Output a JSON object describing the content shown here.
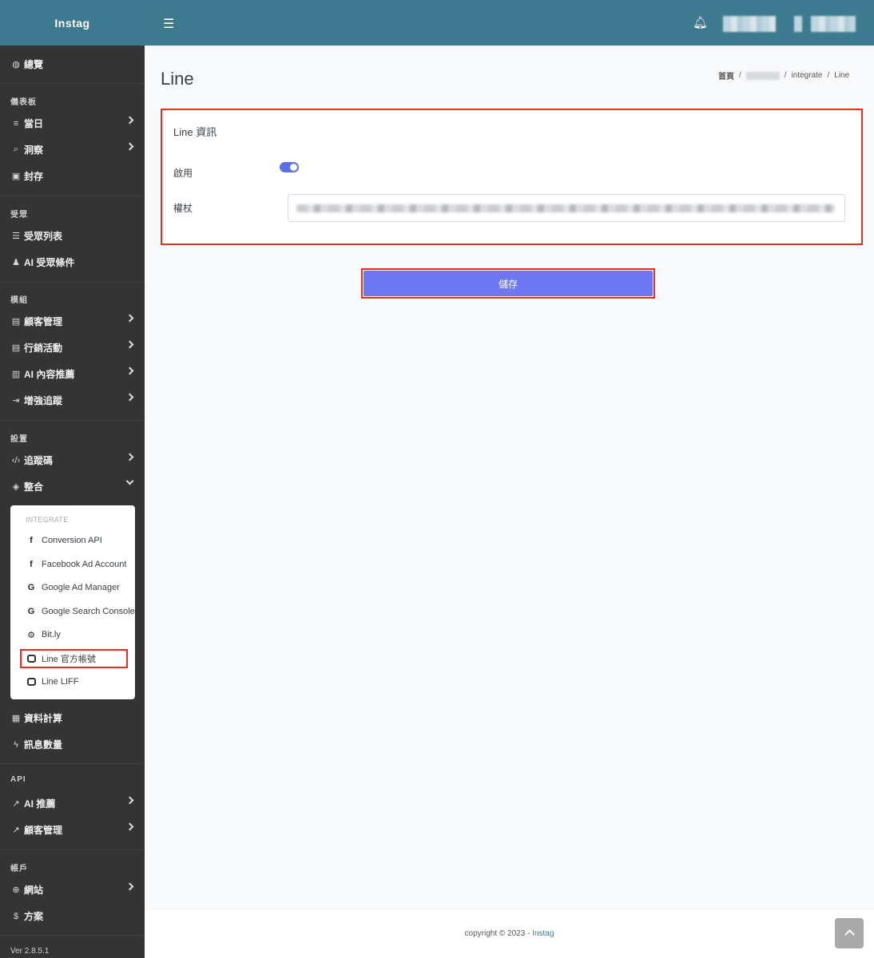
{
  "brand": "Instag",
  "header": {
    "menu_icon": "hamburger-icon",
    "bell_icon": "bell-icon"
  },
  "sidebar": {
    "overview": "總覽",
    "sections": {
      "dashboard": "儀表板",
      "audience": "受眾",
      "modules": "模組",
      "settings": "設置",
      "api": "API",
      "account": "帳戶"
    },
    "items": {
      "daily": "當日",
      "insight": "洞察",
      "archive": "封存",
      "audience_list": "受眾列表",
      "ai_audience": "AI 受眾條件",
      "customer_mgmt": "顧客管理",
      "marketing": "行銷活動",
      "ai_content": "AI 內容推薦",
      "enhanced_tracking": "增強追蹤",
      "tracking_code": "追蹤碼",
      "integration": "整合",
      "data_calc": "資料計算",
      "message_count": "訊息數量",
      "ai_recommend": "AI 推薦",
      "api_customer_mgmt": "顧客管理",
      "website": "網站",
      "plan": "方案"
    },
    "version": "Ver 2.8.5.1"
  },
  "submenu": {
    "header": "INTEGRATE",
    "items": [
      {
        "label": "Conversion API",
        "icon": "facebook-icon"
      },
      {
        "label": "Facebook Ad Account",
        "icon": "facebook-icon"
      },
      {
        "label": "Google Ad Manager",
        "icon": "google-icon"
      },
      {
        "label": "Google Search Console",
        "icon": "google-icon"
      },
      {
        "label": "Bit.ly",
        "icon": "gear-icon"
      },
      {
        "label": "Line 官方帳號",
        "icon": "line-icon"
      },
      {
        "label": "Line LIFF",
        "icon": "line-icon"
      }
    ]
  },
  "page": {
    "title": "Line",
    "breadcrumb": {
      "home": "首頁",
      "sep": "/",
      "integrate": "integrate",
      "current": "Line"
    }
  },
  "card": {
    "title": "Line 資訊",
    "enable_label": "啟用",
    "enabled": true,
    "token_label": "權杖"
  },
  "save_label": "儲存",
  "footer": {
    "copyright": "copyright © 2023 - ",
    "brand": "Instag"
  },
  "colors": {
    "header": "#3d7a90",
    "sidebar": "#343434",
    "accent": "#6c77f1",
    "highlight": "#e4301f"
  }
}
